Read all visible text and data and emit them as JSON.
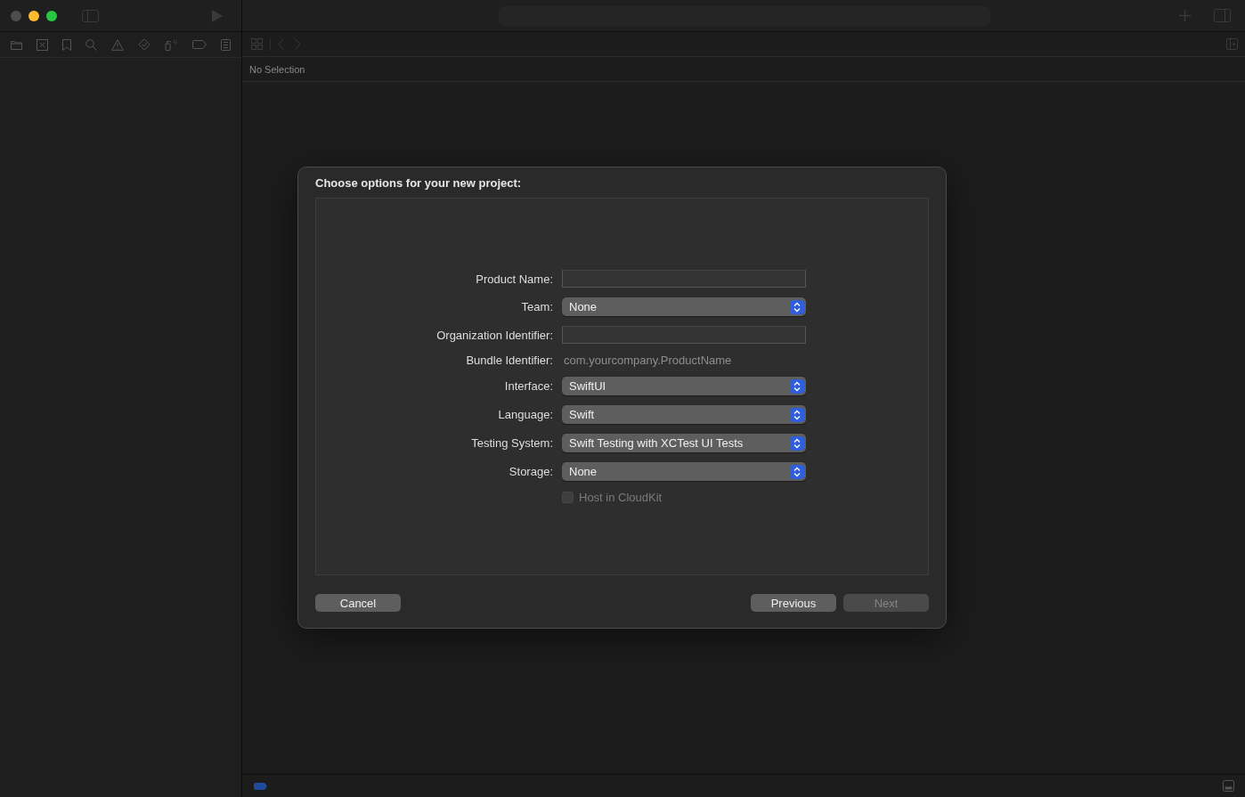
{
  "editor": {
    "breadcrumb": "No Selection"
  },
  "dialog": {
    "title": "Choose options for your new project:",
    "fields": [
      {
        "kind": "text",
        "label": "Product Name:"
      },
      {
        "kind": "popup",
        "label": "Team:",
        "value": "None"
      },
      {
        "kind": "text",
        "label": "Organization Identifier:"
      },
      {
        "kind": "static",
        "label": "Bundle Identifier:",
        "value": "com.yourcompany.ProductName"
      },
      {
        "kind": "popup",
        "label": "Interface:",
        "value": "SwiftUI"
      },
      {
        "kind": "popup",
        "label": "Language:",
        "value": "Swift"
      },
      {
        "kind": "popup",
        "label": "Testing System:",
        "value": "Swift Testing with XCTest UI Tests"
      },
      {
        "kind": "popup",
        "label": "Storage:",
        "value": "None"
      },
      {
        "kind": "checkbox",
        "label": "Host in CloudKit",
        "checked": false,
        "disabled": true
      }
    ],
    "buttons": [
      {
        "label": "Cancel",
        "disabled": false
      },
      {
        "label": "Previous",
        "disabled": false
      },
      {
        "label": "Next",
        "disabled": true
      }
    ]
  }
}
